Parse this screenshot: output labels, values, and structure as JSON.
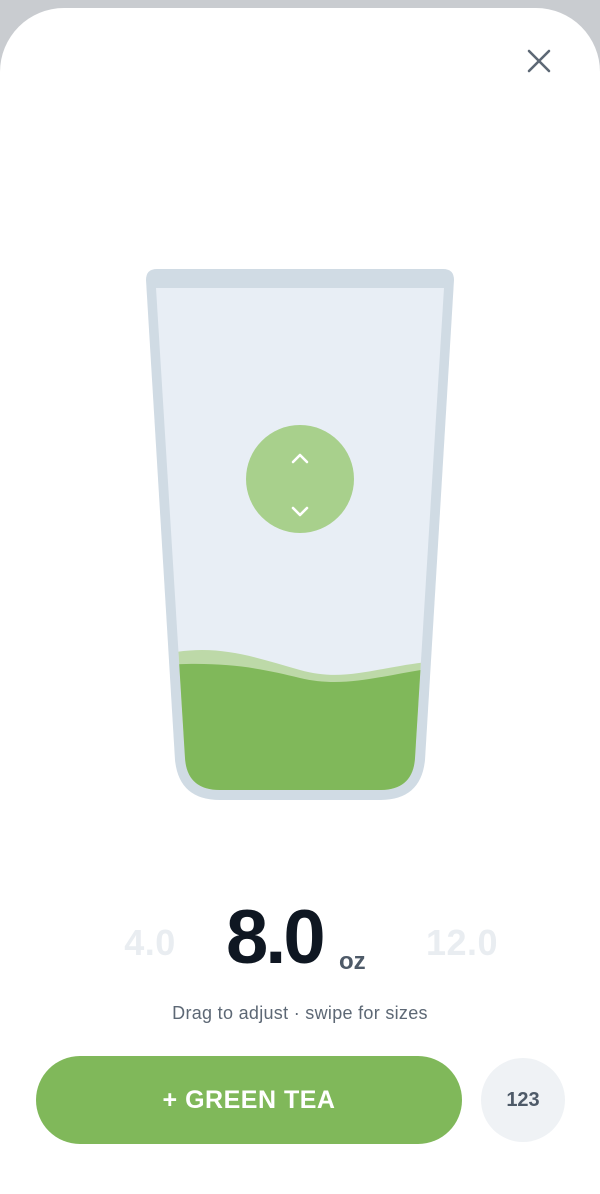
{
  "close": {
    "icon": "close-icon"
  },
  "glass": {
    "drink": "Green Tea",
    "fill_color": "#80b85a",
    "wave_color": "#bdd9a8",
    "glass_outline_color": "#d0dbe4",
    "glass_inner_color": "#e8eef5",
    "handle_color": "#a8d08c",
    "handle_icons": [
      "chevron-up-icon",
      "chevron-down-icon"
    ]
  },
  "amount": {
    "prev_size": "4.0",
    "current": "8.0",
    "next_size": "12.0",
    "unit": "oz"
  },
  "hint": "Drag to adjust · swipe for sizes",
  "actions": {
    "add_label": "+ GREEN TEA",
    "keypad_label": "123"
  }
}
